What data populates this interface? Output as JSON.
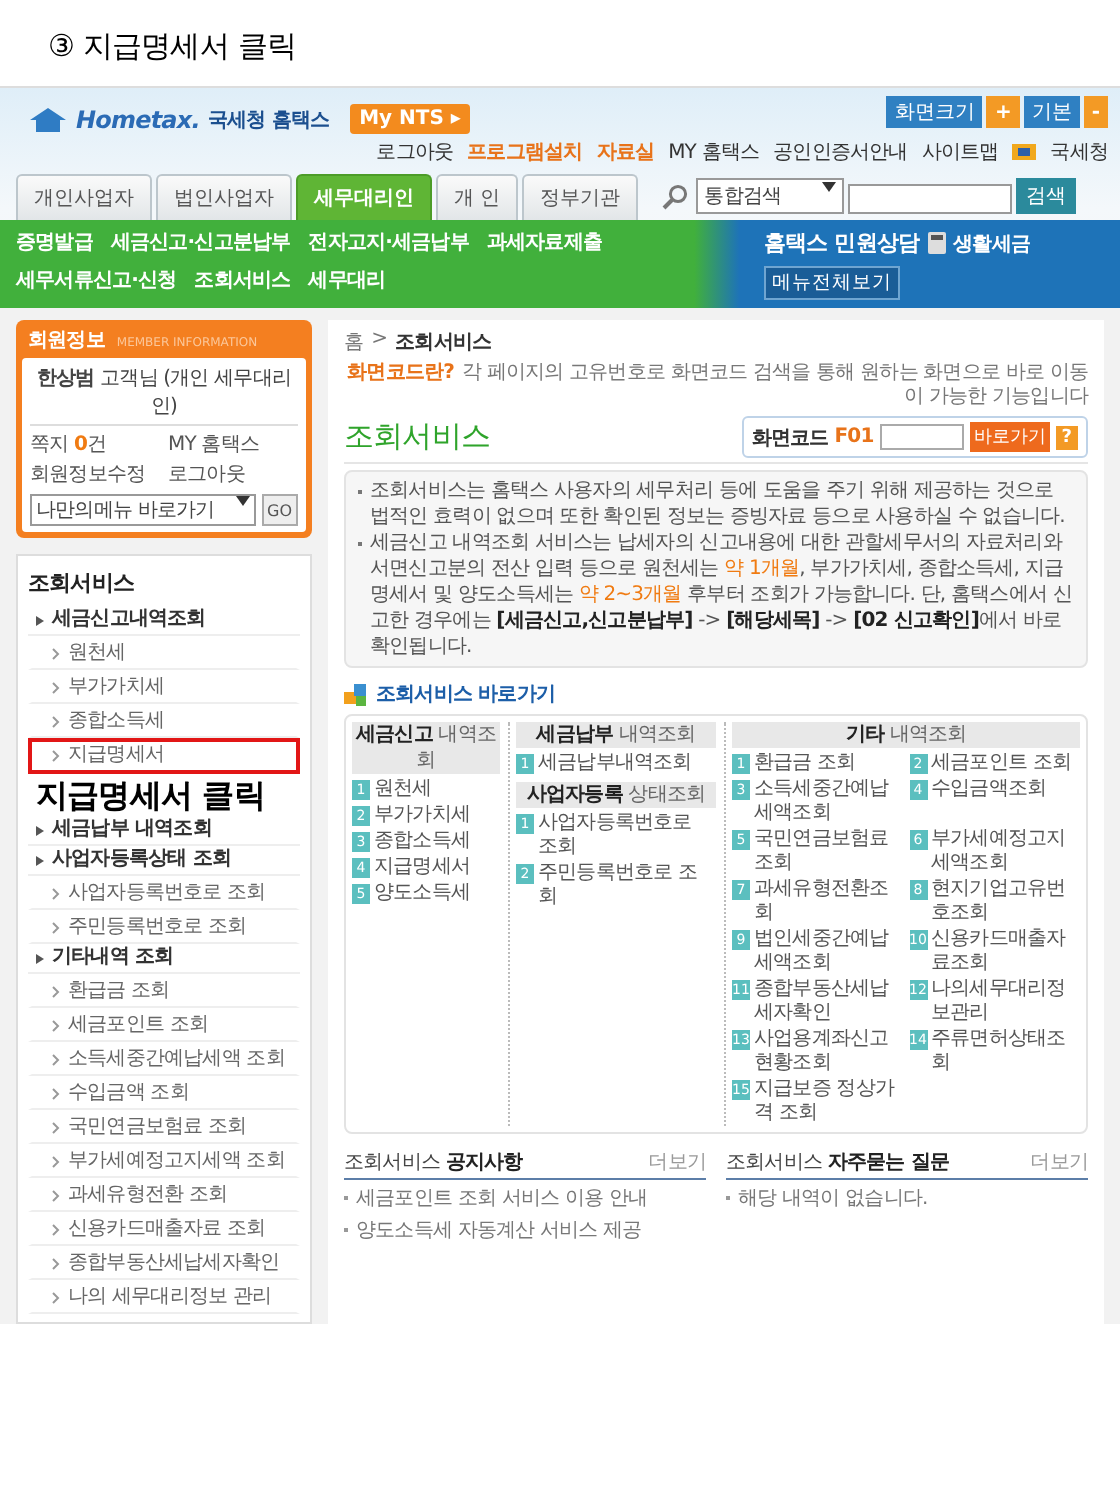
{
  "caption": "③ 지급명세서 클릭",
  "header": {
    "logo": "Hometax.",
    "site_name": "국세청 홈택스",
    "my_nts": "My NTS ▸",
    "size_controls": [
      "화면크기",
      "+",
      "기본",
      "-"
    ],
    "links": [
      {
        "label": "로그아웃",
        "highlight": false,
        "icon": false
      },
      {
        "label": "프로그램설치",
        "highlight": true,
        "icon": false
      },
      {
        "label": "자료실",
        "highlight": true,
        "icon": false
      },
      {
        "label": "MY 홈택스",
        "highlight": false,
        "icon": false
      },
      {
        "label": "공인인증서안내",
        "highlight": false,
        "icon": false
      },
      {
        "label": "사이트맵",
        "highlight": false,
        "icon": false
      },
      {
        "label": "국세청",
        "highlight": false,
        "icon": true
      }
    ]
  },
  "tabs": [
    {
      "label": "개인사업자",
      "selected": false
    },
    {
      "label": "법인사업자",
      "selected": false
    },
    {
      "label": "세무대리인",
      "selected": true
    },
    {
      "label": "개 인",
      "selected": false
    },
    {
      "label": "정부기관",
      "selected": false
    }
  ],
  "search": {
    "scope": "통합검색",
    "button": "검색"
  },
  "nav": {
    "primary": [
      "증명발급",
      "세금신고·신고분납부",
      "전자고지·세금납부",
      "과세자료제출",
      "세무서류신고·신청",
      "조회서비스",
      "세무대리"
    ],
    "secondary": [
      {
        "label": "홈택스 민원상담",
        "kind": "strong"
      },
      {
        "label": "생활세금",
        "kind": "icon"
      },
      {
        "label": "메뉴전체보기",
        "kind": "button"
      }
    ]
  },
  "member": {
    "title": "회원정보",
    "subtitle": "MEMBER INFORMATION",
    "greeting": "**한상범** 고객님 (개인 세무대리인)",
    "links": [
      "쪽지 **0**건",
      "MY 홈택스",
      "회원정보수정",
      "로그아웃"
    ],
    "menu_select": "나만의메뉴 바로가기",
    "go": "GO"
  },
  "sidebar": {
    "title": "조회서비스",
    "sections": [
      {
        "label": "세금신고내역조회",
        "children": [
          {
            "label": "원천세",
            "highlighted": false
          },
          {
            "label": "부가가치세",
            "highlighted": false
          },
          {
            "label": "종합소득세",
            "highlighted": false
          },
          {
            "label": "지급명세서",
            "highlighted": true,
            "annotation": "지급명세서 클릭"
          }
        ]
      },
      {
        "label": "세금납부 내역조회"
      },
      {
        "label": "사업자등록상태 조회",
        "children": [
          {
            "label": "사업자등록번호로 조회",
            "highlighted": false
          },
          {
            "label": "주민등록번호로 조회",
            "highlighted": false
          }
        ]
      },
      {
        "label": "기타내역 조회",
        "children": [
          {
            "label": "환급금 조회",
            "highlighted": false
          },
          {
            "label": "세금포인트 조회",
            "highlighted": false
          },
          {
            "label": "소득세중간예납세액 조회",
            "highlighted": false
          },
          {
            "label": "수입금액 조회",
            "highlighted": false
          },
          {
            "label": "국민연금보험료 조회",
            "highlighted": false
          },
          {
            "label": "부가세예정고지세액 조회",
            "highlighted": false
          },
          {
            "label": "과세유형전환 조회",
            "highlighted": false
          },
          {
            "label": "신용카드매출자료 조회",
            "highlighted": false
          },
          {
            "label": "종합부동산세납세자확인",
            "highlighted": false
          },
          {
            "label": "나의 세무대리정보 관리",
            "highlighted": false
          }
        ]
      }
    ]
  },
  "breadcrumb": {
    "items": [
      "홈",
      "조회서비스"
    ],
    "separator": ">"
  },
  "screen_code": {
    "help_link": "화면코드란?",
    "help_text": "각 페이지의 고유번호로 화면코드 검색을 통해 원하는 화면으로 바로 이동이 가능한 기능입니다",
    "label": "화면코드",
    "code": "F01",
    "go": "바로가기",
    "help": "?"
  },
  "page_title": "조회서비스",
  "notice": [
    "조회서비스는 홈택스 사용자의 세무처리 등에 도움을 주기 위해 제공하는 것으로 법적인 효력이 없으며 또한 확인된 정보는 증빙자료 등으로 사용하실 수 없습니다.",
    "세금신고 내역조회 서비스는 납세자의 신고내용에 대한 관할세무서의 자료처리와 서면신고분의 전산 입력 등으로 원천세는 *약 1개월*, 부가가치세, 종합소득세, 지급명세서 및 양도소득세는 *약 2~3개월* 후부터 조회가 가능합니다. 단, 홈택스에서 신고한 경우에는 **[세금신고,신고분납부]** -> **[해당세목]** -> **[02 신고확인]**에서 바로 확인됩니다."
  ],
  "shortcuts": {
    "title": "조회서비스 바로가기",
    "columns": [
      {
        "groups": [
          {
            "heading": "**세금신고** 내역조회",
            "items": [
              {
                "number": "1",
                "label": "원천세"
              },
              {
                "number": "2",
                "label": "부가가치세"
              },
              {
                "number": "3",
                "label": "종합소득세"
              },
              {
                "number": "4",
                "label": "지급명세서"
              },
              {
                "number": "5",
                "label": "양도소득세"
              }
            ]
          }
        ]
      },
      {
        "groups": [
          {
            "heading": "**세금납부** 내역조회",
            "items": [
              {
                "number": "1",
                "label": "세금납부내역조회"
              }
            ]
          },
          {
            "heading": "**사업자등록** 상태조회",
            "items": [
              {
                "number": "1",
                "label": "사업자등록번호로 조회"
              },
              {
                "number": "2",
                "label": "주민등록번호로 조회"
              }
            ]
          }
        ]
      },
      {
        "groups": [
          {
            "heading": "**기타** 내역조회",
            "items": [
              {
                "number": "1",
                "label": "환급금 조회"
              },
              {
                "number": "2",
                "label": "세금포인트 조회"
              },
              {
                "number": "3",
                "label": "소득세중간예납세액조회"
              },
              {
                "number": "4",
                "label": "수입금액조회"
              },
              {
                "number": "5",
                "label": "국민연금보험료조회"
              },
              {
                "number": "6",
                "label": "부가세예정고지세액조회"
              },
              {
                "number": "7",
                "label": "과세유형전환조회"
              },
              {
                "number": "8",
                "label": "현지기업고유번호조회"
              },
              {
                "number": "9",
                "label": "법인세중간예납세액조회"
              },
              {
                "number": "10",
                "label": "신용카드매출자료조회"
              },
              {
                "number": "11",
                "label": "종합부동산세납세자확인"
              },
              {
                "number": "12",
                "label": "나의세무대리정보관리"
              },
              {
                "number": "13",
                "label": "사업용계좌신고현황조회"
              },
              {
                "number": "14",
                "label": "주류면허상태조회"
              },
              {
                "number": "15",
                "label": "지급보증 정상가격 조회"
              }
            ]
          }
        ]
      }
    ]
  },
  "boards": [
    {
      "title": "조회서비스 **공지사항**",
      "more": "더보기",
      "items": [
        "세금포인트 조회 서비스 이용 안내",
        "양도소득세 자동계산 서비스 제공"
      ]
    },
    {
      "title": "조회서비스 **자주묻는 질문**",
      "more": "더보기",
      "items": [
        "해당 내역이 없습니다."
      ]
    }
  ]
}
